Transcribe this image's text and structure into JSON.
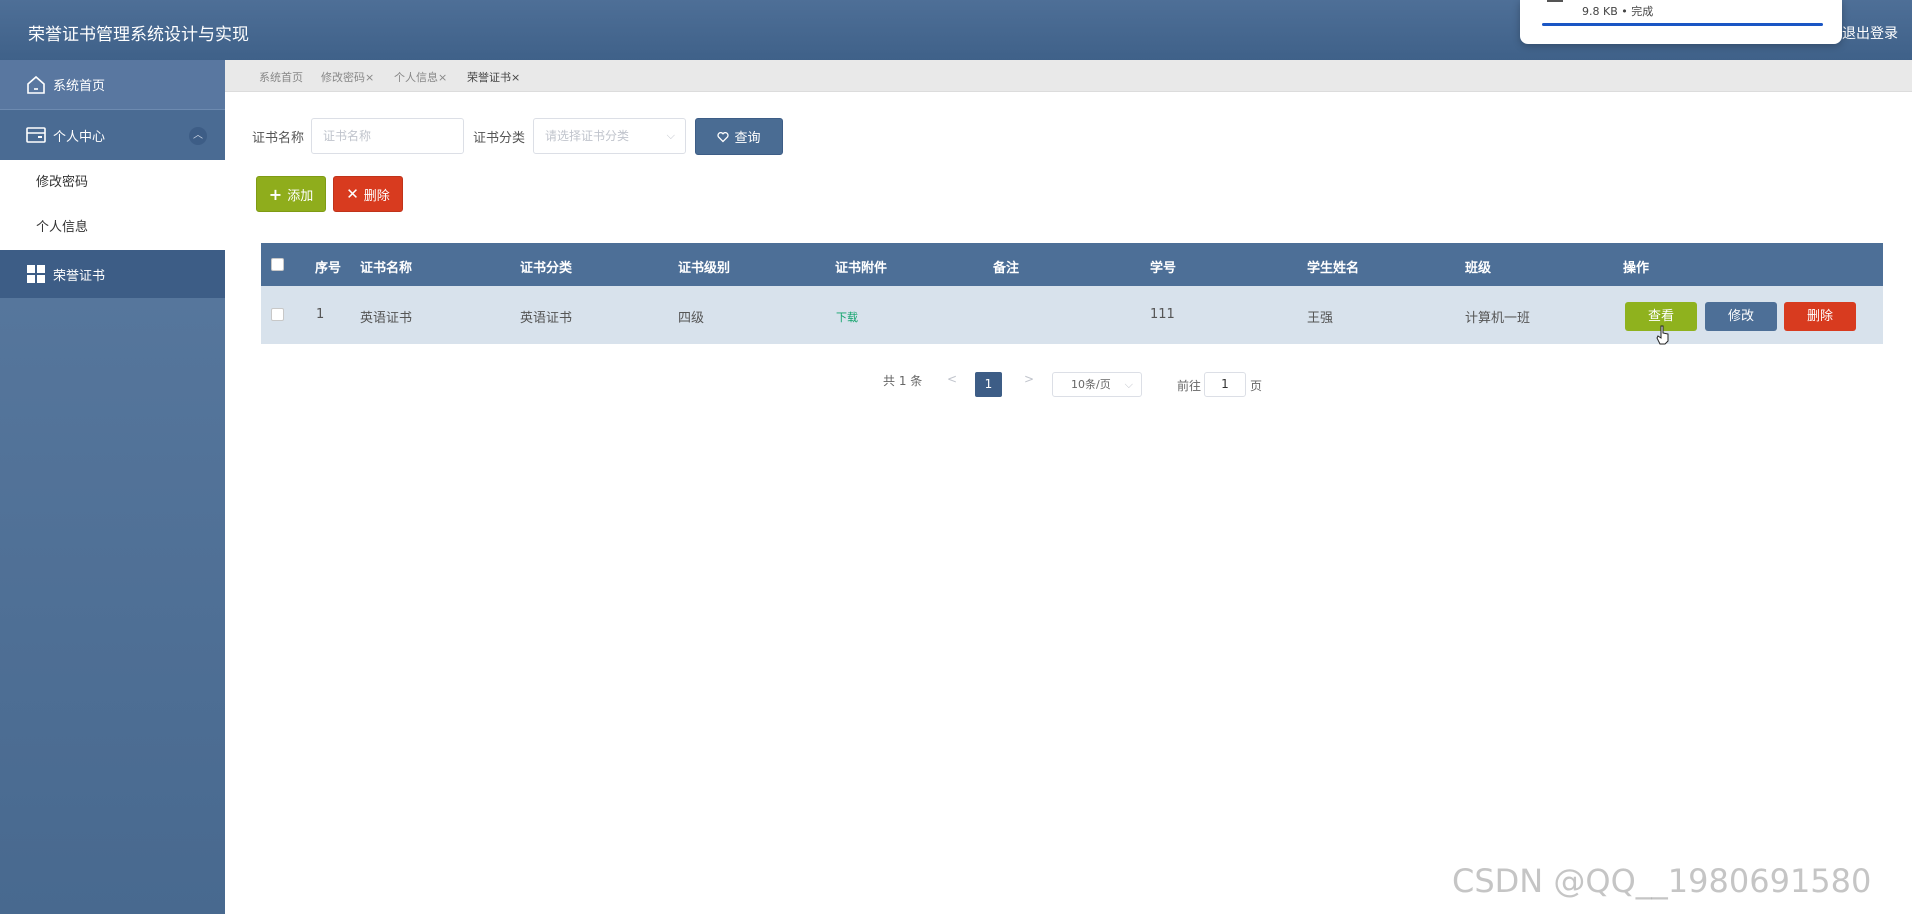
{
  "header": {
    "app_title": "荣誉证书管理系统设计与实现",
    "logout_label": "退出登录"
  },
  "download_popup": {
    "status": "9.8 KB • 完成"
  },
  "sidebar": {
    "items": [
      {
        "label": "系统首页",
        "icon": "home-icon"
      },
      {
        "label": "个人中心",
        "icon": "wallet-icon",
        "expanded": true,
        "children": [
          {
            "label": "修改密码"
          },
          {
            "label": "个人信息"
          }
        ]
      },
      {
        "label": "荣誉证书",
        "icon": "grid-icon",
        "active": true
      }
    ]
  },
  "tabs": [
    {
      "label": "系统首页"
    },
    {
      "label": "修改密码"
    },
    {
      "label": "个人信息"
    },
    {
      "label": "荣誉证书",
      "active": true
    }
  ],
  "tab_close_glyph": "×",
  "search": {
    "name_label": "证书名称",
    "name_placeholder": "证书名称",
    "category_label": "证书分类",
    "category_placeholder": "请选择证书分类",
    "query_button": "查询"
  },
  "toolbar": {
    "add_button": "添加",
    "delete_button": "删除"
  },
  "table": {
    "columns": [
      "序号",
      "证书名称",
      "证书分类",
      "证书级别",
      "证书附件",
      "备注",
      "学号",
      "学生姓名",
      "班级",
      "操作"
    ],
    "rows": [
      {
        "index": "1",
        "cert_name": "英语证书",
        "category": "英语证书",
        "level": "四级",
        "attachment": "下载",
        "remark": "",
        "student_id": "111",
        "student_name": "王强",
        "class": "计算机一班",
        "actions": {
          "view": "查看",
          "edit": "修改",
          "delete": "删除"
        }
      }
    ]
  },
  "pagination": {
    "total": "共 1 条",
    "prev": "<",
    "current_page": "1",
    "next": ">",
    "page_size": "10条/页",
    "goto_label": "前往",
    "goto_value": "1",
    "goto_suffix": "页"
  },
  "watermark": "CSDN @QQ__1980691580",
  "colors": {
    "header_bg": "#4a6c93",
    "sidebar_bg": "#5071a0",
    "active_menu": "#3d5d86",
    "add_green": "#8fad1c",
    "delete_red": "#d83b1f",
    "table_head": "#4d6f97",
    "row_bg": "#d8e2ec",
    "download_link": "#12a46c"
  }
}
